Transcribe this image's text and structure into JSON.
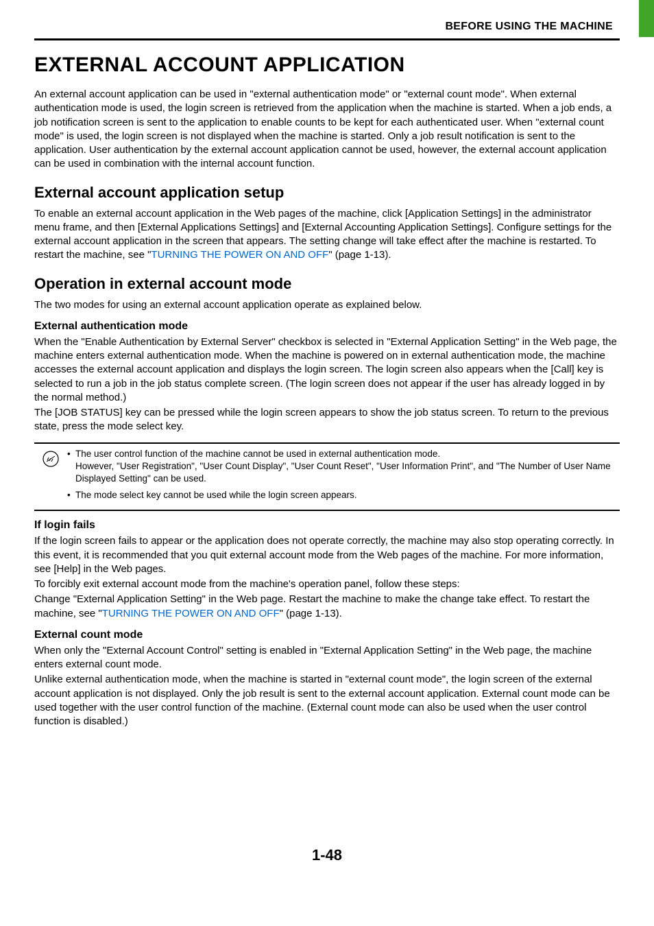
{
  "header": {
    "chapter": "BEFORE USING THE MACHINE"
  },
  "title": "EXTERNAL ACCOUNT APPLICATION",
  "intro": "An external account application can be used in \"external authentication mode\" or \"external count mode\". When external authentication mode is used, the login screen is retrieved from the application when the machine is started. When a job ends, a job notification screen is sent to the application to enable counts to be kept for each authenticated user. When \"external count mode\" is used, the login screen is not displayed when the machine is started. Only a job result notification is sent to the application. User authentication by the external account application cannot be used, however, the external account application can be used in combination with the internal account function.",
  "section1": {
    "heading": "External account application setup",
    "body_pre": "To enable an external account application in the Web pages of the machine, click [Application Settings] in the administrator menu frame, and then [External Applications Settings] and [External Accounting Application Settings]. Configure settings for the external account application in the screen that appears. The setting change will take effect after the machine is restarted. To restart the machine, see \"",
    "link": "TURNING THE POWER ON AND OFF",
    "body_post": "\" (page 1-13)."
  },
  "section2": {
    "heading": "Operation in external account mode",
    "intro": "The two modes for using an external account application operate as explained below.",
    "sub1": {
      "heading": "External authentication mode",
      "p1": "When the \"Enable Authentication by External Server\" checkbox is selected in \"External Application Setting\" in the Web page, the machine enters external authentication mode. When the machine is powered on in external authentication mode, the machine accesses the external account application and displays the login screen. The login screen also appears when the [Call] key is selected to run a job in the job status complete screen. (The login screen does not appear if the user has already logged in by the normal method.)",
      "p2": "The [JOB STATUS] key can be pressed while the login screen appears to show the job status screen. To return to the previous state, press the mode select key."
    },
    "note": {
      "item1": "The user control function of the machine cannot be used in external authentication mode.\nHowever, \"User Registration\", \"User Count Display\", \"User Count Reset\", \"User Information Print\", and \"The Number of User Name Displayed Setting\" can be used.",
      "item2": "The mode select key cannot be used while the login screen appears."
    },
    "sub2": {
      "heading": "If login fails",
      "p1": "If the login screen fails to appear or the application does not operate correctly, the machine may also stop operating correctly. In this event, it is recommended that you quit external account mode from the Web pages of the machine. For more information, see [Help] in the Web pages.",
      "p2": "To forcibly exit external account mode from the machine's operation panel, follow these steps:",
      "p3_pre": "Change \"External Application Setting\" in the Web page. Restart the machine to make the change take effect. To restart the machine, see \"",
      "link": "TURNING THE POWER ON AND OFF",
      "p3_post": "\" (page 1-13)."
    },
    "sub3": {
      "heading": "External count mode",
      "p1": "When only the \"External Account Control\" setting is enabled in \"External Application Setting\" in the Web page, the machine enters external count mode.",
      "p2": "Unlike external authentication mode, when the machine is started in \"external count mode\", the login screen of the external account application is not displayed. Only the job result is sent to the external account application. External count mode can be used together with the user control function of the machine. (External count mode can also be used when the user control function is disabled.)"
    }
  },
  "page_number": "1-48"
}
